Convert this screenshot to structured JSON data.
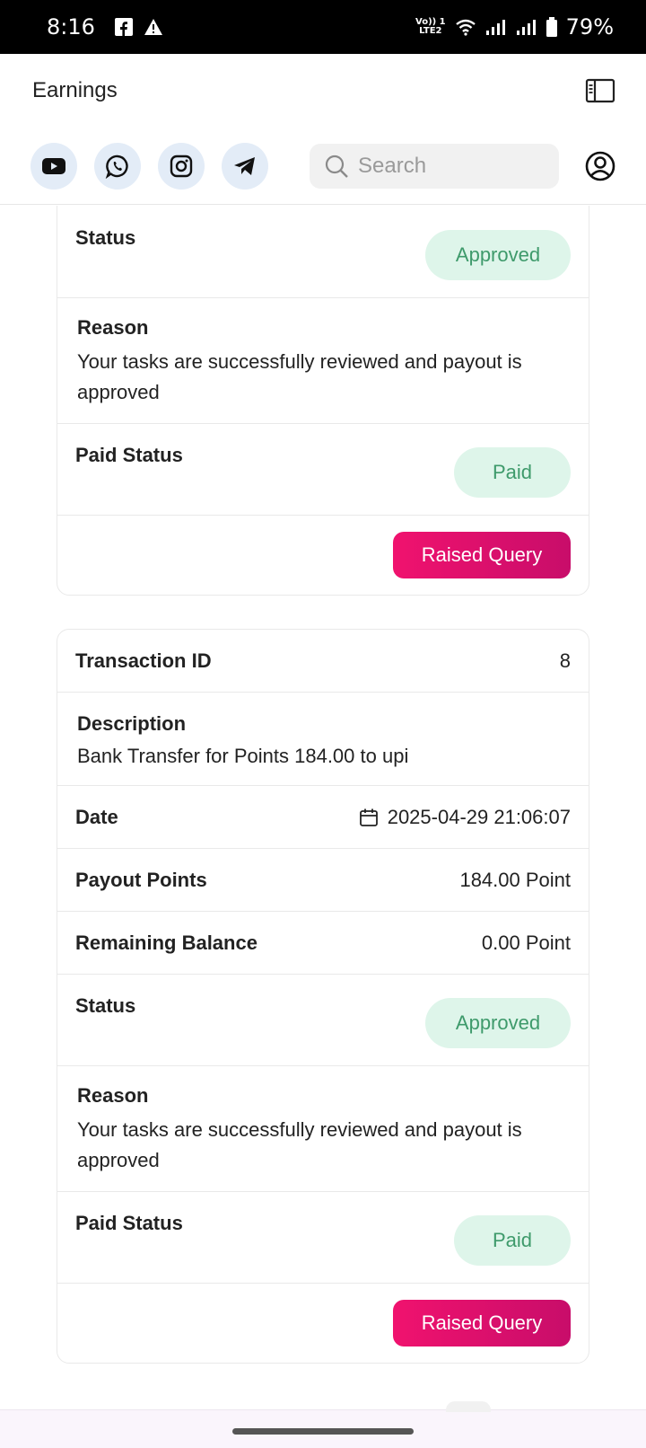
{
  "statusbar": {
    "time": "8:16",
    "battery": "79%",
    "volte": [
      "Vo)) 1",
      "LTE2"
    ]
  },
  "appbar": {
    "title": "Earnings"
  },
  "social": {
    "icons": [
      "youtube-icon",
      "whatsapp-icon",
      "instagram-icon",
      "telegram-icon"
    ]
  },
  "search": {
    "placeholder": "Search"
  },
  "card1": {
    "status_label": "Status",
    "status_value": "Approved",
    "reason_label": "Reason",
    "reason_text": "Your tasks are successfully reviewed and payout is approved",
    "paid_label": "Paid Status",
    "paid_value": "Paid",
    "query_button": "Raised Query"
  },
  "card2": {
    "txn_label": "Transaction ID",
    "txn_value": "8",
    "desc_label": "Description",
    "desc_text": "Bank Transfer for Points 184.00 to upi",
    "date_label": "Date",
    "date_value": "2025-04-29 21:06:07",
    "payout_label": "Payout Points",
    "payout_value": "184.00 Point",
    "balance_label": "Remaining Balance",
    "balance_value": "0.00 Point",
    "status_label": "Status",
    "status_value": "Approved",
    "reason_label": "Reason",
    "reason_text": "Your tasks are successfully reviewed and payout is approved",
    "paid_label": "Paid Status",
    "paid_value": "Paid",
    "query_button": "Raised Query"
  },
  "colors": {
    "accent": "#e8106e",
    "approved_bg": "#def5ea",
    "approved_text": "#3e9a6b",
    "social_bg": "#e3ecf7"
  }
}
